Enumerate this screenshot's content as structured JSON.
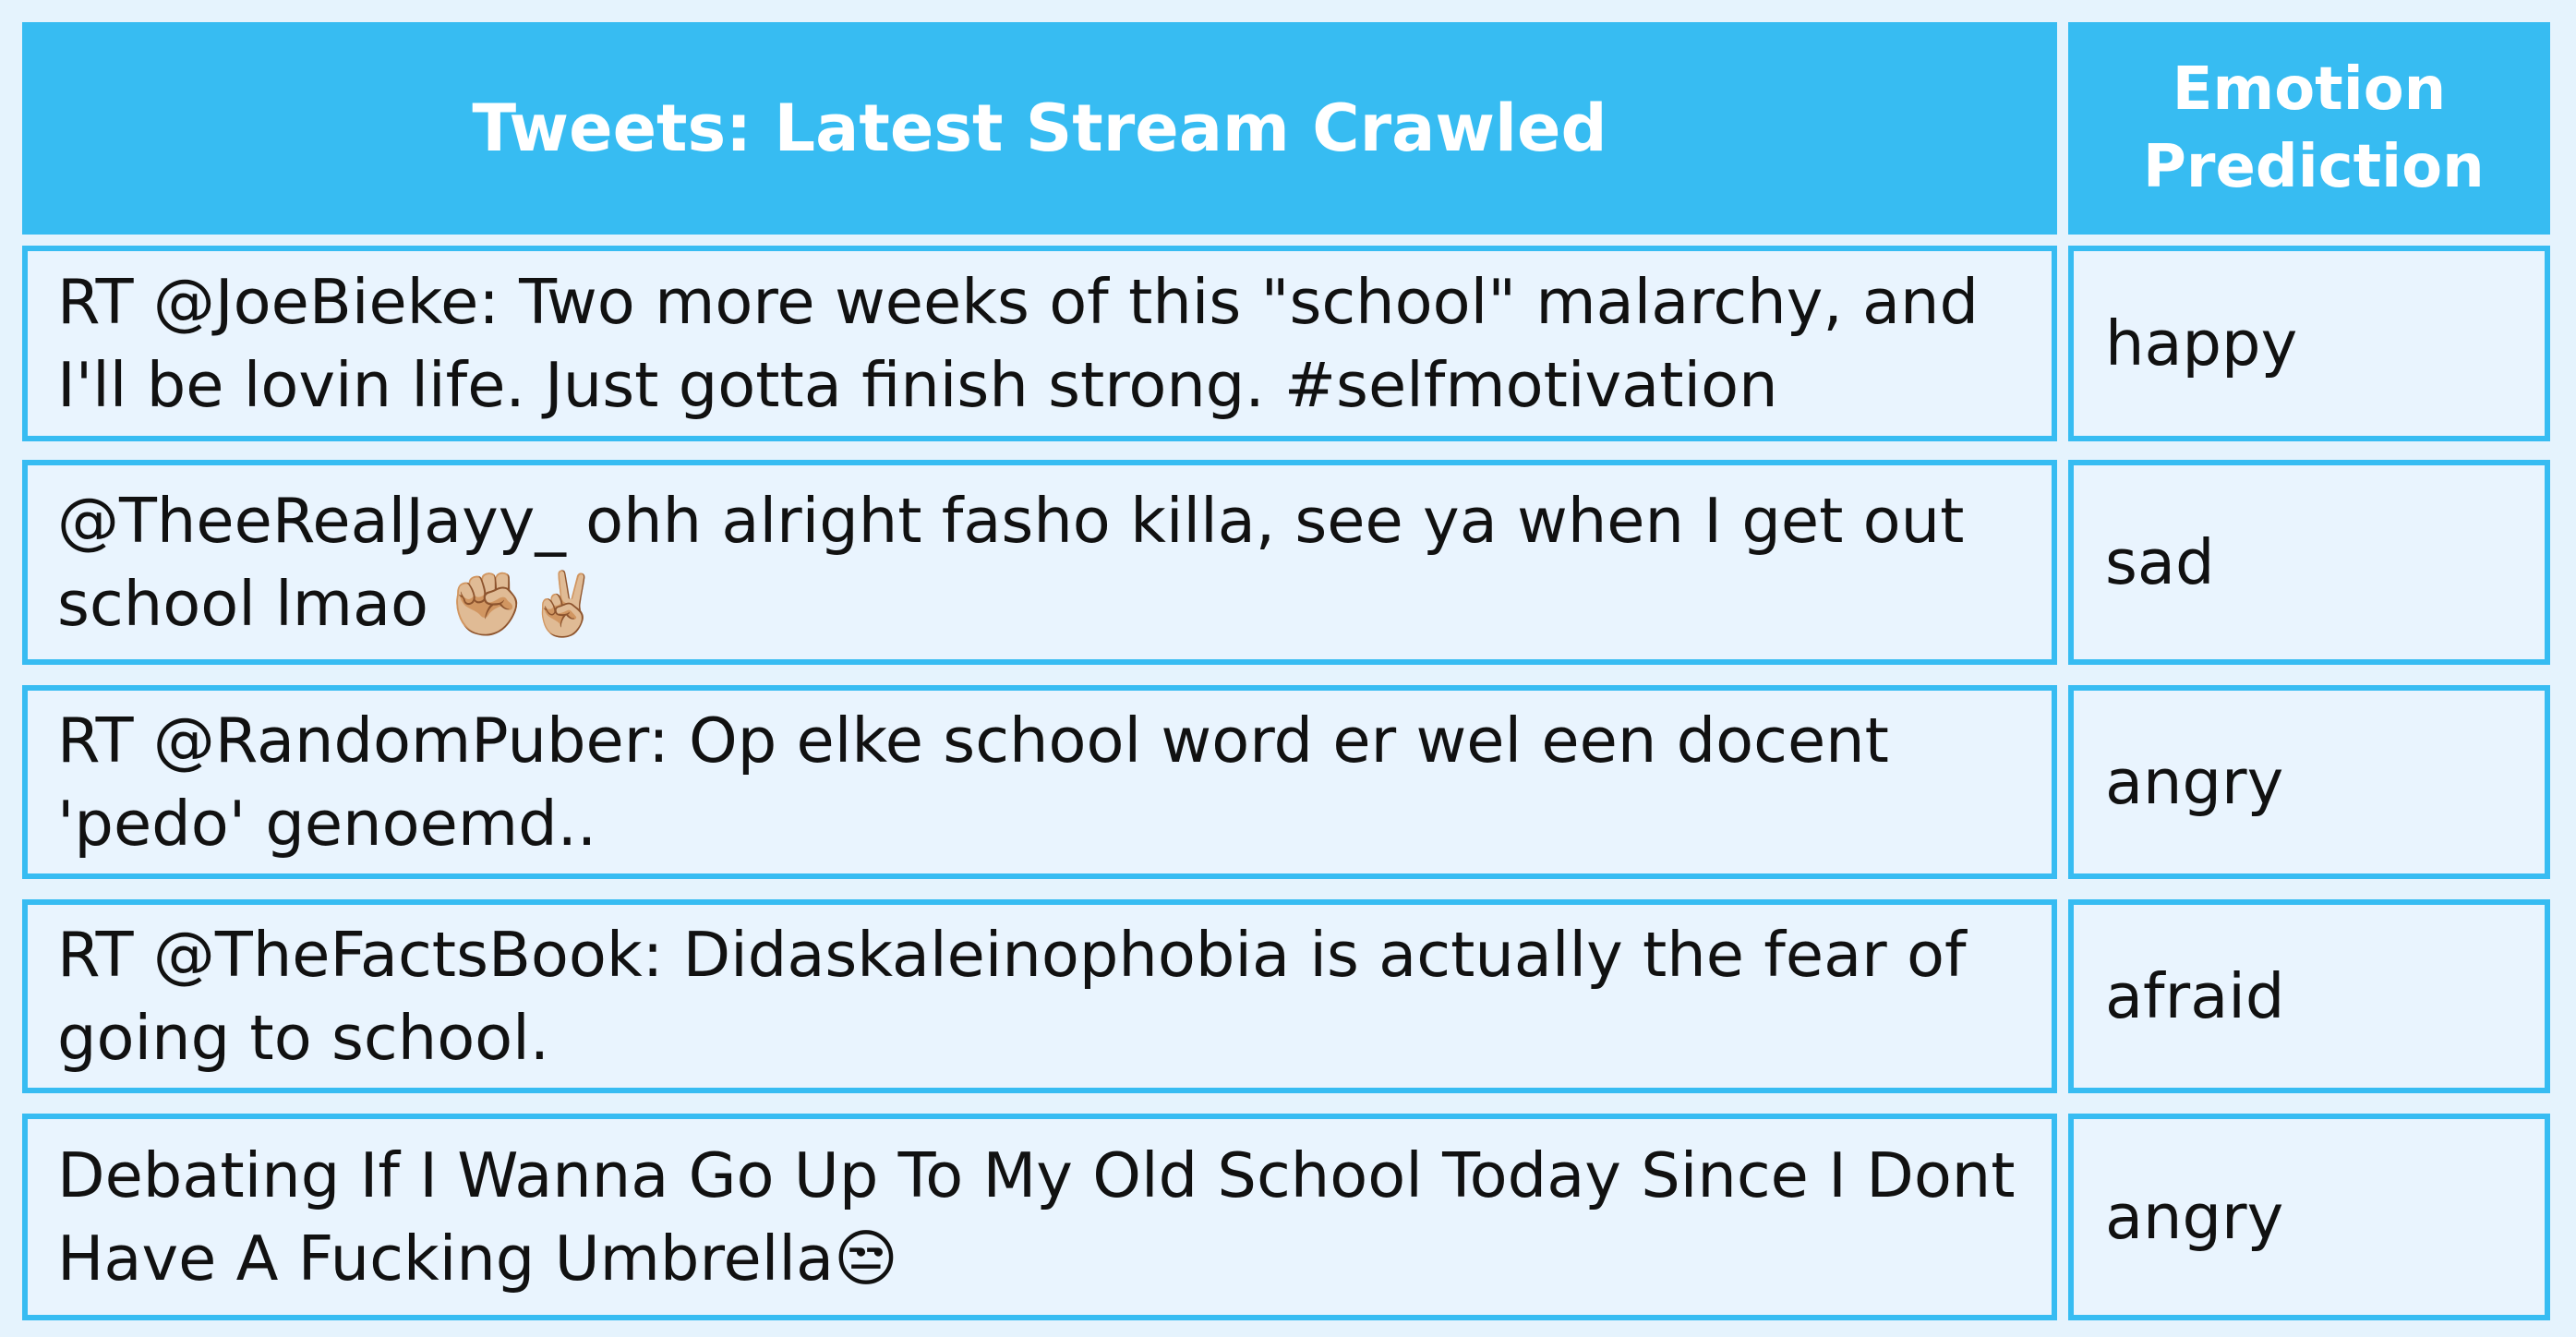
{
  "table": {
    "headers": {
      "tweets": "Tweets: Latest Stream Crawled",
      "emotion": "Emotion Prediction"
    },
    "rows": [
      {
        "tweet": "RT @JoeBieke: Two more weeks of this \"school\" malarchy, and I'll be lovin life. Just gotta finish strong. #selfmotivation",
        "emotion": "happy"
      },
      {
        "tweet": "@TheeRealJayy_ ohh alright fasho killa, see ya when I get out school lmao ✊🏼✌🏼",
        "emotion": "sad"
      },
      {
        "tweet": "RT @RandomPuber: Op elke school word er wel een docent 'pedo' genoemd..",
        "emotion": "angry"
      },
      {
        "tweet": "RT @TheFactsBook: Didaskaleinophobia is actually the fear of going to school.",
        "emotion": "afraid"
      },
      {
        "tweet": "Debating If I Wanna Go Up To My Old School Today Since I Dont Have A Fucking Umbrella😒",
        "emotion": "angry"
      }
    ]
  },
  "colors": {
    "header_bg": "#37bcf2",
    "border": "#37bcf2",
    "cell_bg": "#e9f4fe"
  }
}
